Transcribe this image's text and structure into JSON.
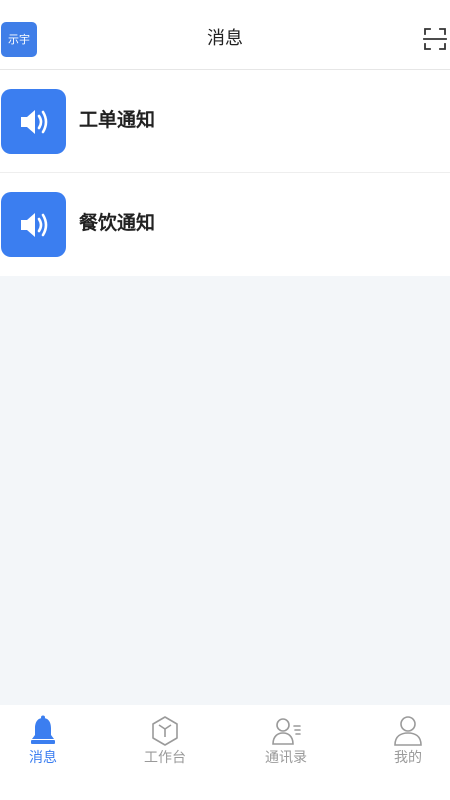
{
  "header": {
    "title": "消息",
    "avatar_text": "示宇",
    "scan_icon": "scan-icon"
  },
  "messages": [
    {
      "label": "工单通知",
      "icon": "speaker-icon"
    },
    {
      "label": "餐饮通知",
      "icon": "speaker-icon"
    }
  ],
  "tabbar": {
    "items": [
      {
        "label": "消息",
        "icon": "bell-icon",
        "active": true
      },
      {
        "label": "工作台",
        "icon": "cube-icon",
        "active": false
      },
      {
        "label": "通讯录",
        "icon": "contacts-icon",
        "active": false
      },
      {
        "label": "我的",
        "icon": "user-icon",
        "active": false
      }
    ]
  },
  "colors": {
    "accent": "#3b7ef0",
    "inactive": "#9a9a9a",
    "background": "#f3f6f9"
  }
}
